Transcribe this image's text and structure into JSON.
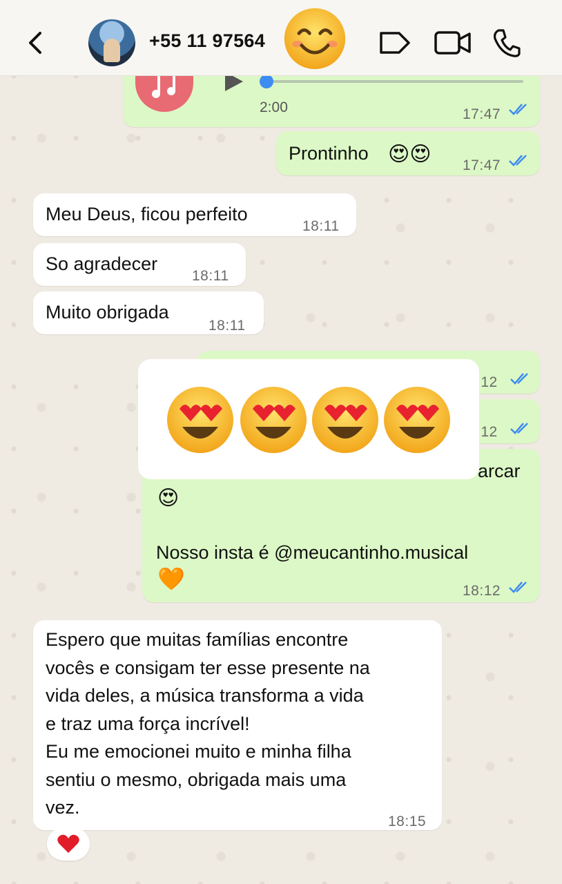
{
  "header": {
    "contact": "+55 11 97564",
    "icons": [
      "back-icon",
      "avatar",
      "smiling-face-emoji",
      "tag-icon",
      "video-icon",
      "phone-icon"
    ]
  },
  "messages": {
    "audio": {
      "duration": "2:00",
      "time": "17:47"
    },
    "prontinho": {
      "text": "Prontinho",
      "time": "17:47"
    },
    "meu_deus": {
      "text": "Meu Deus, ficou perfeito",
      "time": "18:11"
    },
    "so_agradecer": {
      "text": "So agradecer",
      "time": "18:11"
    },
    "muito_obrigada": {
      "text": "Muito obrigada",
      "time": "18:11"
    },
    "hidden1": {
      "time": ":12"
    },
    "hidden2": {
      "time": ":12"
    },
    "marcar": {
      "text_partial": "arcar",
      "line2": "Nosso insta é @meucantinho.musical",
      "time": "18:12"
    },
    "espero": {
      "lines": [
        "Espero que muitas famílias encontre",
        "vocês e consigam ter esse presente na",
        "vida deles, a  música transforma a vida",
        "e traz uma força incrível!",
        "Eu me emocionei muito e minha filha",
        "sentiu o mesmo, obrigada mais uma",
        "vez."
      ],
      "time": "18:15"
    }
  },
  "colors": {
    "outgoing": "#dcf8c6",
    "incoming": "#ffffff",
    "ticks": "#3e8cf2",
    "background": "#efeae2"
  }
}
